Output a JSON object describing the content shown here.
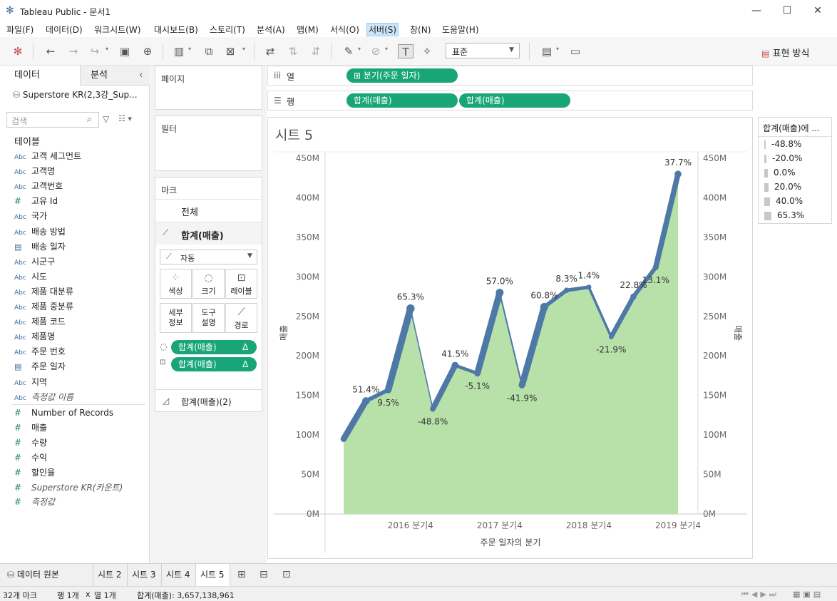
{
  "window": {
    "title": "Tableau Public - 문서1"
  },
  "menu": [
    "파일(F)",
    "데이터(D)",
    "워크시트(W)",
    "대시보드(B)",
    "스토리(T)",
    "분석(A)",
    "맵(M)",
    "서식(O)",
    "서버(S)",
    "창(N)",
    "도움말(H)"
  ],
  "toolbar": {
    "format_select": "표준",
    "show_me": "표현 방식"
  },
  "left_panel": {
    "tab_data": "데이터",
    "tab_analysis": "분석",
    "datasource": "Superstore KR(2,3강_Sup...",
    "search_placeholder": "검색",
    "section_tables": "테이블",
    "dimensions": [
      {
        "type": "Abc",
        "name": "고객 세그먼트"
      },
      {
        "type": "Abc",
        "name": "고객명"
      },
      {
        "type": "Abc",
        "name": "고객번호"
      },
      {
        "type": "#",
        "name": "고유 Id"
      },
      {
        "type": "Abc",
        "name": "국가"
      },
      {
        "type": "Abc",
        "name": "배송 방법"
      },
      {
        "type": "date",
        "name": "배송 일자"
      },
      {
        "type": "Abc",
        "name": "시군구"
      },
      {
        "type": "Abc",
        "name": "시도"
      },
      {
        "type": "Abc",
        "name": "제품 대분류"
      },
      {
        "type": "Abc",
        "name": "제품 중분류"
      },
      {
        "type": "Abc",
        "name": "제품 코드"
      },
      {
        "type": "Abc",
        "name": "제품명"
      },
      {
        "type": "Abc",
        "name": "주문 번호"
      },
      {
        "type": "date",
        "name": "주문 일자"
      },
      {
        "type": "Abc",
        "name": "지역"
      },
      {
        "type": "Abc",
        "name": "측정값 이름",
        "italic": true
      }
    ],
    "measures": [
      {
        "type": "#",
        "name": "Number of Records"
      },
      {
        "type": "#",
        "name": "매출"
      },
      {
        "type": "#",
        "name": "수량"
      },
      {
        "type": "#",
        "name": "수익"
      },
      {
        "type": "#",
        "name": "할인율"
      },
      {
        "type": "#",
        "name": "Superstore KR(카운트)",
        "italic": true
      },
      {
        "type": "#",
        "name": "측정값",
        "italic": true
      }
    ]
  },
  "shelves": {
    "pages": "페이지",
    "filters": "필터",
    "marks": "마크",
    "marks_all": "전체",
    "marks_measure": "합계(매출)",
    "mark_type": "자동",
    "mark_buttons": [
      "색상",
      "크기",
      "레이블",
      "세부\n정보",
      "도구\n설명",
      "경로"
    ],
    "mark_pill_1": "합계(매출)",
    "mark_pill_2": "합계(매출)",
    "pill_delta": "Δ",
    "marks_measure2": "합계(매출)(2)",
    "columns_label": "열",
    "rows_label": "행",
    "columns_pill": "분기(주문 일자)",
    "rows_pill_1": "합계(매출)",
    "rows_pill_2": "합계(매출)"
  },
  "legend": {
    "title": "합계(매출)에 ...",
    "items": [
      "-48.8%",
      "-20.0%",
      "0.0%",
      "20.0%",
      "40.0%",
      "65.3%"
    ]
  },
  "chart_data": {
    "type": "area",
    "title": "시트 5",
    "xlabel": "주문 일자의 분기",
    "ylabel": "매출",
    "ylim": [
      0,
      450000000
    ],
    "yticks": [
      "0M",
      "50M",
      "100M",
      "150M",
      "200M",
      "250M",
      "300M",
      "350M",
      "400M",
      "450M"
    ],
    "xticks": [
      "2016 분기4",
      "2017 분기4",
      "2018 분기4",
      "2019 분기4"
    ],
    "series": [
      {
        "name": "합계(매출)",
        "values": [
          95000000,
          143000000,
          157000000,
          260000000,
          133000000,
          188000000,
          178000000,
          280000000,
          163000000,
          262000000,
          283000000,
          287000000,
          224000000,
          275000000,
          312000000,
          430000000
        ]
      }
    ],
    "labels": [
      "",
      "51.4%",
      "9.5%",
      "65.3%",
      "-48.8%",
      "41.5%",
      "-5.1%",
      "57.0%",
      "-41.9%",
      "60.8%",
      "8.3%",
      "1.4%",
      "-21.9%",
      "22.8%",
      "13.1%",
      "37.7%"
    ],
    "pct_change": [
      0,
      51.4,
      9.5,
      65.3,
      -48.8,
      41.5,
      -5.1,
      57.0,
      -41.9,
      60.8,
      8.3,
      1.4,
      -21.9,
      22.8,
      13.1,
      37.7
    ],
    "colors": {
      "line": "#4e79a7",
      "area": "#b7e1a9"
    }
  },
  "tabs": {
    "datasource": "데이터 원본",
    "sheets": [
      "시트 2",
      "시트 3",
      "시트 4",
      "시트 5"
    ],
    "active": "시트 5"
  },
  "status": {
    "marks": "32개 마크",
    "rows": "행 1개",
    "x": "x",
    "cols": "열 1개",
    "sum": "합계(매출): 3,657,138,961"
  }
}
